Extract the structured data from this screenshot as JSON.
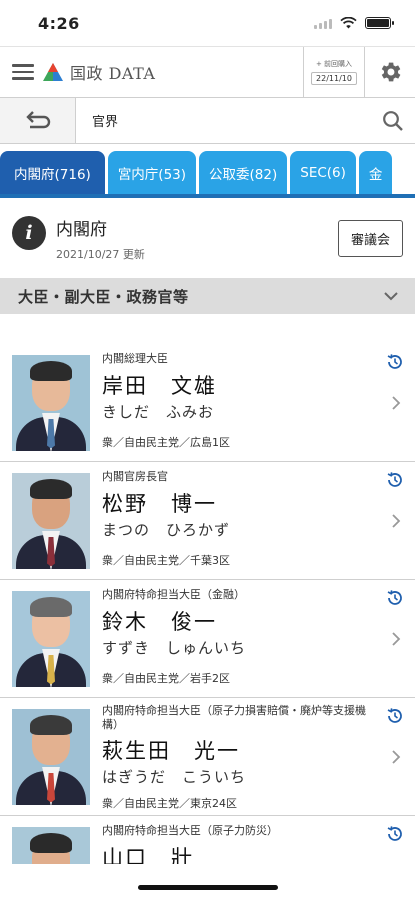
{
  "status_bar": {
    "time": "4:26"
  },
  "header": {
    "logo_text": "国政 DATA",
    "date_label": "+ 前回購入",
    "date_value": "22/11/10",
    "colors": {
      "logo_red": "#e8432f",
      "logo_green": "#3ea65a",
      "logo_blue": "#2d7fd1"
    }
  },
  "search": {
    "value": "官界"
  },
  "tabs": [
    {
      "label": "内閣府(716)",
      "active": true
    },
    {
      "label": "宮内庁(53)",
      "active": false
    },
    {
      "label": "公取委(82)",
      "active": false
    },
    {
      "label": "SEC(6)",
      "active": false
    },
    {
      "label": "金",
      "active": false
    }
  ],
  "agency": {
    "name": "内閣府",
    "updated": "2021/10/27 更新",
    "council_button": "審議会"
  },
  "section": {
    "title": "大臣・副大臣・政務官等"
  },
  "members": [
    {
      "post": "内閣総理大臣",
      "name": "岸田　文雄",
      "kana": "きしだ　ふみお",
      "meta": "衆／自由民主党／広島1区"
    },
    {
      "post": "内閣官房長官",
      "name": "松野　博一",
      "kana": "まつの　ひろかず",
      "meta": "衆／自由民主党／千葉3区"
    },
    {
      "post": "内閣府特命担当大臣（金融）",
      "name": "鈴木　俊一",
      "kana": "すずき　しゅんいち",
      "meta": "衆／自由民主党／岩手2区"
    },
    {
      "post": "内閣府特命担当大臣（原子力損害賠償・廃炉等支援機構）",
      "name": "萩生田　光一",
      "kana": "はぎうだ　こういち",
      "meta": "衆／自由民主党／東京24区"
    },
    {
      "post": "内閣府特命担当大臣（原子力防災）",
      "name": "山口　壯",
      "kana": "",
      "meta": ""
    }
  ],
  "colors": {
    "tab_active": "#1f5fae",
    "tab": "#2aa3e6",
    "history_icon": "#1f5fae"
  }
}
